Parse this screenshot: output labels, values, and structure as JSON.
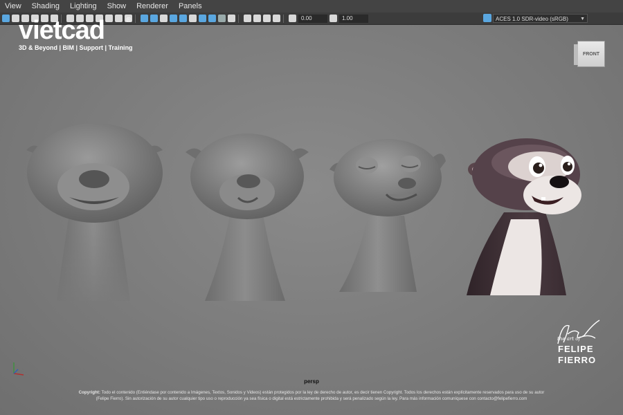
{
  "menu": [
    "View",
    "Shading",
    "Lighting",
    "Show",
    "Renderer",
    "Panels"
  ],
  "toolbar": {
    "exposure": "0.00",
    "gamma": "1.00",
    "color_management": "ACES 1.0 SDR-video (sRGB)"
  },
  "logo": {
    "title": "vietcad",
    "registered": "®",
    "tagline": "3D & Beyond | BIM | Support | Training"
  },
  "viewcube": {
    "label": "FRONT"
  },
  "camera_label": "persp",
  "signature": {
    "small": "the art of",
    "name_line1": "FELIPE",
    "name_line2": "FIERRO"
  },
  "copyright": {
    "label": "Copyright:",
    "line1": "Todo el contenido (Entiéndase por contenido a Imágenes, Textos, Sonidos y Videos) están protegidos por la ley de derecho de autor, es decir tienen Copyright. Todos los derechos están explícitamente reservados para uso de su autor",
    "line2": "(Felipe Fierro). Sin autorización de su autor cualquier tipo uso o reproducción ya sea física o digital está estrictamente prohibida y será penalizado según la ley. Para más información comuníquese con contacto@felipefierro.com"
  },
  "colors": {
    "viewport": "#7b7b7b",
    "menubar": "#444444",
    "toolbar": "#3c3c3c",
    "sculpt_gray": "#8a8a8a",
    "otter_dark": "#4a3a40",
    "otter_light": "#ece6e4"
  }
}
